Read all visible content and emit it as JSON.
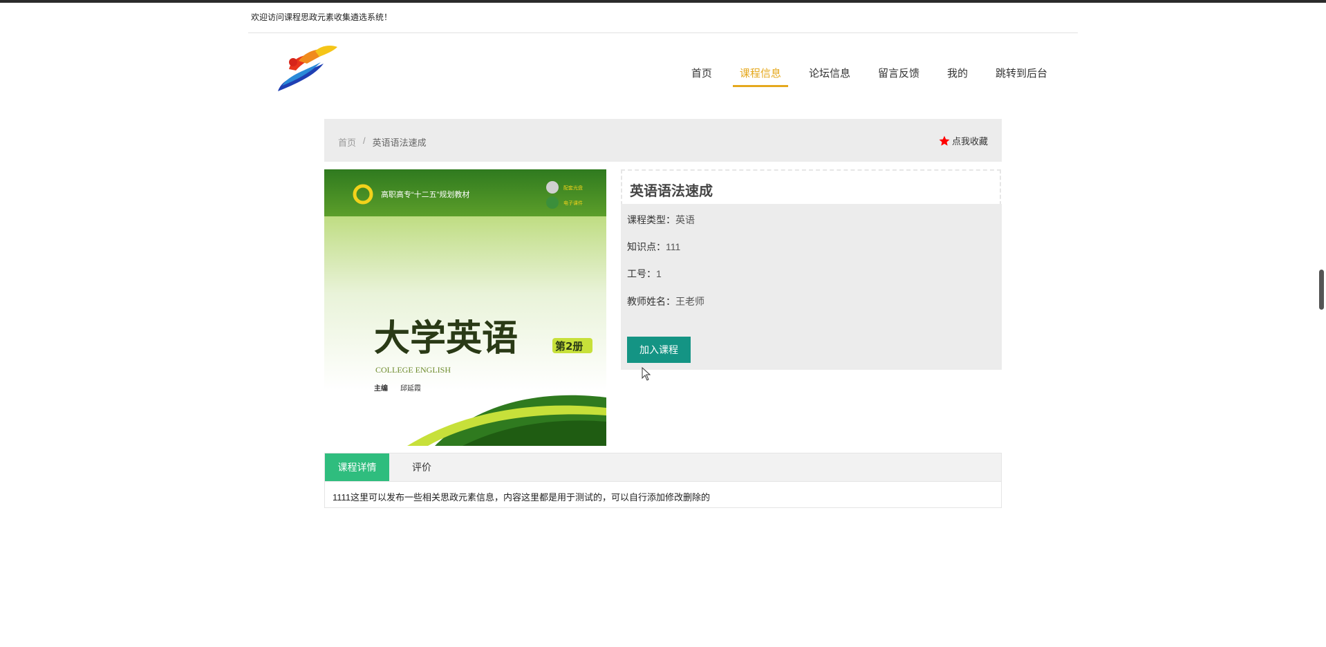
{
  "header": {
    "welcome": "欢迎访问课程思政元素收集遴选系统！"
  },
  "nav": {
    "items": [
      "首页",
      "课程信息",
      "论坛信息",
      "留言反馈",
      "我的",
      "跳转到后台"
    ],
    "active_index": 1
  },
  "breadcrumb": {
    "home": "首页",
    "separator": "/",
    "current": "英语语法速成"
  },
  "favorite": {
    "label": "点我收藏",
    "icon": "star-icon",
    "color": "#ff0000"
  },
  "cover": {
    "series": "高职高专“十二五”规划教材",
    "badge1": "配套光盘",
    "badge2": "电子课件",
    "title": "大学英语",
    "volume": "第2册",
    "subtitle": "COLLEGE ENGLISH",
    "editor_label": "主编",
    "editor_name": "邱延霞"
  },
  "course": {
    "title": "英语语法速成",
    "type_label": "课程类型：",
    "type_value": "英语",
    "knowledge_label": "知识点：",
    "knowledge_value": "111",
    "id_label": "工号：",
    "id_value": "1",
    "teacher_label": "教师姓名：",
    "teacher_value": "王老师",
    "join_button": "加入课程"
  },
  "tabs": {
    "items": [
      "课程详情",
      "评价"
    ],
    "active_index": 0,
    "content": "1111这里可以发布一些相关思政元素信息，内容这里都是用于测试的，可以自行添加修改删除的"
  },
  "colors": {
    "accent_nav": "#e5a81d",
    "join_button": "#149484",
    "tab_active": "#2fbd7e"
  }
}
